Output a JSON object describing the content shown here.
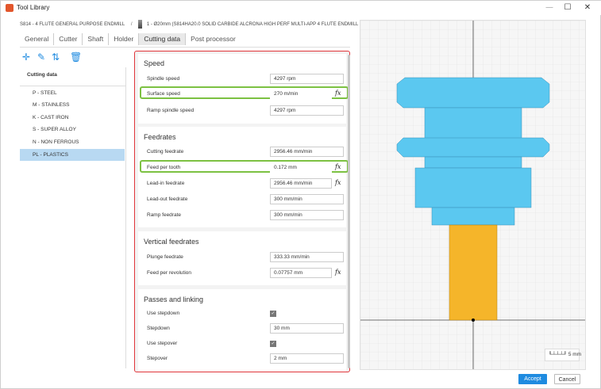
{
  "window": {
    "title": "Tool Library"
  },
  "breadcrumb": {
    "library": "S814 - 4 FLUTE GENERAL PURPOSE ENDMILL",
    "separator": "/",
    "tool": "1 - Ø20mm (S814HA20.0 SOLID CARBIDE ALCRONA HIGH PERF MULTI-APP 4 FLUTE ENDMILL"
  },
  "tabs": [
    "General",
    "Cutter",
    "Shaft",
    "Holder",
    "Cutting data",
    "Post processor"
  ],
  "active_tab": "Cutting data",
  "toolbar_icons": [
    "add-icon",
    "edit-icon",
    "swap-icon",
    "delete-icon"
  ],
  "left_panel": {
    "header": "Cutting data",
    "items": [
      "P - STEEL",
      "M - STAINLESS",
      "K - CAST IRON",
      "S - SUPER ALLOY",
      "N - NON FERROUS",
      "PL - PLASTICS"
    ],
    "selected": "PL - PLASTICS"
  },
  "speed": {
    "title": "Speed",
    "spindle_speed": {
      "label": "Spindle speed",
      "value": "4297 rpm"
    },
    "surface_speed": {
      "label": "Surface speed",
      "value": "270 m/min"
    },
    "ramp_spindle_speed": {
      "label": "Ramp spindle speed",
      "value": "4297 rpm"
    }
  },
  "feedrates": {
    "title": "Feedrates",
    "cutting_feedrate": {
      "label": "Cutting feedrate",
      "value": "2956.46 mm/min"
    },
    "feed_per_tooth": {
      "label": "Feed per tooth",
      "value": "0.172 mm"
    },
    "lead_in_feedrate": {
      "label": "Lead-in feedrate",
      "value": "2956.46 mm/min"
    },
    "lead_out_feedrate": {
      "label": "Lead-out feedrate",
      "value": "300 mm/min"
    },
    "ramp_feedrate": {
      "label": "Ramp feedrate",
      "value": "300 mm/min"
    }
  },
  "vertical_feedrates": {
    "title": "Vertical feedrates",
    "plunge_feedrate": {
      "label": "Plunge feedrate",
      "value": "333.33 mm/min"
    },
    "feed_per_revolution": {
      "label": "Feed per revolution",
      "value": "0.07757 mm"
    }
  },
  "passes": {
    "title": "Passes and linking",
    "use_stepdown": {
      "label": "Use stepdown",
      "checked": true
    },
    "stepdown": {
      "label": "Stepdown",
      "value": "30 mm"
    },
    "use_stepover": {
      "label": "Use stepover",
      "checked": true
    },
    "stepover": {
      "label": "Stepover",
      "value": "2 mm"
    }
  },
  "fx_label": "fx",
  "viewport": {
    "scale_label": "5 mm",
    "holder_color": "#5bc8f0",
    "cutter_color": "#f5b52a"
  },
  "buttons": {
    "accept": "Accept",
    "cancel": "Cancel"
  },
  "colors": {
    "accent": "#1f8be0",
    "highlight_border": "#e0353a",
    "row_highlight": "#7cc142",
    "selected_item": "#b8d9f2"
  }
}
